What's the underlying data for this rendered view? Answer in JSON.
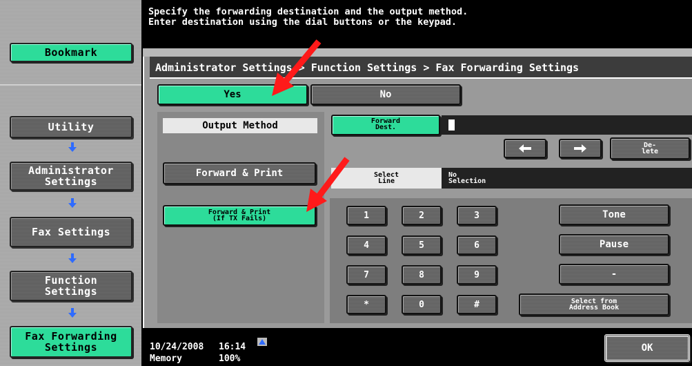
{
  "message": {
    "line1": "Specify the forwarding destination and the output method.",
    "line2": "Enter destination using the dial buttons or the keypad."
  },
  "sidebar": {
    "bookmark": "Bookmark",
    "items": [
      {
        "label": "Utility"
      },
      {
        "label": "Administrator\nSettings"
      },
      {
        "label": "Fax Settings"
      },
      {
        "label": "Function\nSettings"
      },
      {
        "label": "Fax Forwarding\nSettings"
      }
    ]
  },
  "breadcrumb": "Administrator Settings > Function Settings > Fax Forwarding Settings",
  "toggle": {
    "yes": "Yes",
    "no": "No"
  },
  "output": {
    "title": "Output Method",
    "forward_print": "Forward & Print",
    "forward_print_fail_1": "Forward & Print",
    "forward_print_fail_2": "(If TX Fails)"
  },
  "dest": {
    "button_1": "Forward",
    "button_2": "Dest.",
    "value": ""
  },
  "edit": {
    "delete_1": "De-",
    "delete_2": "lete"
  },
  "line": {
    "label_1": "Select",
    "label_2": "Line",
    "value_1": "No",
    "value_2": "Selection"
  },
  "keypad": [
    "1",
    "2",
    "3",
    "4",
    "5",
    "6",
    "7",
    "8",
    "9",
    "*",
    "0",
    "#"
  ],
  "side_keys": {
    "tone": "Tone",
    "pause": "Pause",
    "dash": "-",
    "address_1": "Select from",
    "address_2": "Address Book"
  },
  "footer": {
    "date": "10/24/2008",
    "time": "16:14",
    "memory_label": "Memory",
    "memory_value": "100%",
    "ok": "OK"
  },
  "colors": {
    "accent": "#2ddc9a",
    "arrow": "#ff1a1a",
    "nav_arrow": "#2f6bff"
  }
}
